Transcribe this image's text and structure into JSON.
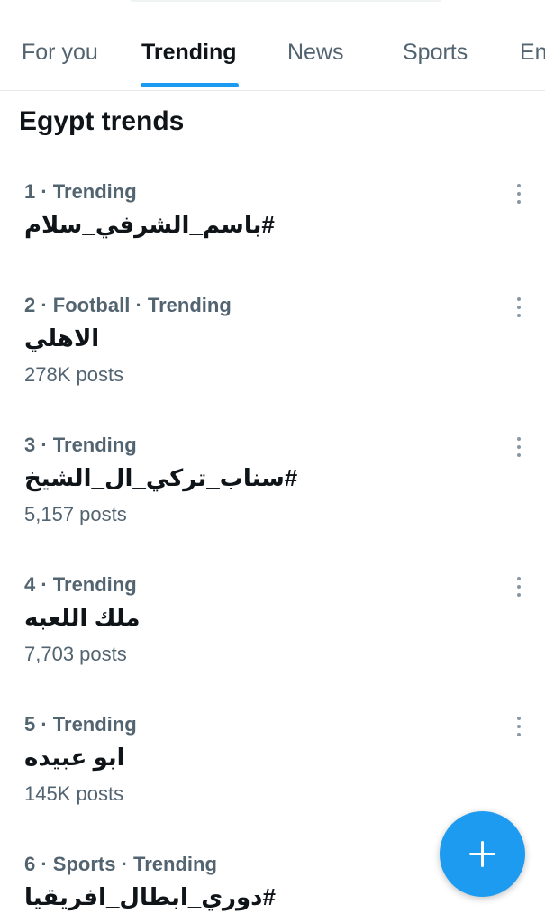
{
  "tabs": [
    {
      "label": "For you",
      "active": false
    },
    {
      "label": "Trending",
      "active": true
    },
    {
      "label": "News",
      "active": false
    },
    {
      "label": "Sports",
      "active": false
    },
    {
      "label": "En",
      "active": false
    }
  ],
  "section_title": "Egypt trends",
  "trends": [
    {
      "meta": "1 · Trending",
      "name": "#باسم_الشرفي_سلام",
      "posts": ""
    },
    {
      "meta": "2 · Football · Trending",
      "name": "الاهلي",
      "posts": "278K posts"
    },
    {
      "meta": "3 · Trending",
      "name": "#سناب_تركي_ال_الشيخ",
      "posts": "5,157 posts"
    },
    {
      "meta": "4 · Trending",
      "name": "ملك اللعبه",
      "posts": "7,703 posts"
    },
    {
      "meta": "5 · Trending",
      "name": "ابو عبيده",
      "posts": "145K posts"
    },
    {
      "meta": "6 · Sports · Trending",
      "name": "#دوري_ابطال_افريقيا",
      "posts": ""
    }
  ],
  "icons": {
    "more": "more-vertical-icon",
    "fab": "plus-icon"
  },
  "colors": {
    "accent": "#1d9bf0",
    "secondary_text": "#536471",
    "primary_text": "#0f1419"
  }
}
